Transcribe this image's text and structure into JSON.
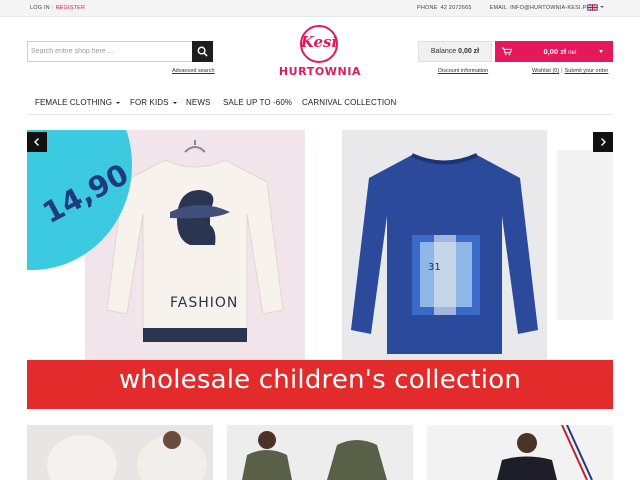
{
  "topbar": {
    "login": "LOG IN",
    "separator": "|",
    "register": "REGISTER",
    "phone_label": "PHONE",
    "phone_value": "42 2072665",
    "email_label": "EMAIL",
    "email_value": "INFO@HURTOWNIA-KESI.PL",
    "language_icon": "uk-flag-icon"
  },
  "search": {
    "placeholder": "Search entire shop here ...",
    "value": "",
    "button_icon": "search-icon",
    "advanced_link": "Advanced search"
  },
  "logo": {
    "script": "Kesi",
    "name": "HURTOWNIA"
  },
  "account": {
    "balance_label": "Balance",
    "balance_value": "0,00 zł",
    "cart_total": "0,00 zł",
    "cart_suffix": "net",
    "cart_icon": "cart-icon",
    "discount_link": "Discount information",
    "wishlist_link": "Wishlist (0)",
    "separator": "|",
    "submit_order_link": "Submit your order"
  },
  "nav": {
    "items": [
      {
        "label": "FEMALE CLOTHING",
        "has_dropdown": true
      },
      {
        "label": "FOR KIDS",
        "has_dropdown": true
      },
      {
        "label": "NEWS",
        "has_dropdown": false
      },
      {
        "label": "SALE UP TO -60%",
        "has_dropdown": false
      },
      {
        "label": "CARNIVAL COLLECTION",
        "has_dropdown": false
      }
    ]
  },
  "slider": {
    "price_badge": "14,90",
    "shirt1_print": "FASHION",
    "prev_icon": "chevron-left-icon",
    "next_icon": "chevron-right-icon",
    "banner_text": "wholesale children's collection"
  },
  "colors": {
    "brand": "#e4185a",
    "badge": "#3ccae0",
    "banner": "#e42b2b"
  }
}
